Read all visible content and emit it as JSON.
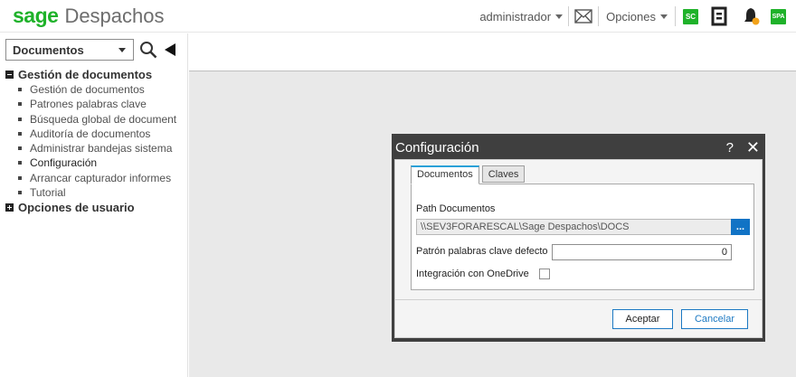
{
  "header": {
    "brand": "sage",
    "app_name": "Despachos",
    "user_menu": "administrador",
    "options_menu": "Opciones",
    "badge_sc": "SC",
    "badge_spa": "SPA",
    "icons": [
      "envelope-icon",
      "document-icon",
      "bell-icon"
    ],
    "colors": {
      "brand_green": "#1fb22a",
      "bell_dot": "#f2a21a"
    }
  },
  "sidebar": {
    "module_selector": "Documentos",
    "groups": [
      {
        "label": "Gestión de documentos",
        "expanded": true,
        "items": [
          {
            "label": "Gestión de documentos"
          },
          {
            "label": "Patrones palabras clave"
          },
          {
            "label": "Búsqueda global de document"
          },
          {
            "label": "Auditoría de documentos"
          },
          {
            "label": "Administrar bandejas sistema"
          },
          {
            "label": "Configuración",
            "active": true
          },
          {
            "label": "Arrancar capturador informes"
          },
          {
            "label": "Tutorial"
          }
        ]
      },
      {
        "label": "Opciones de usuario",
        "expanded": false
      }
    ]
  },
  "dialog": {
    "title": "Configuración",
    "help": "?",
    "close": "✕",
    "tabs": [
      {
        "label": "Documentos",
        "active": true
      },
      {
        "label": "Claves",
        "active": false
      }
    ],
    "path_label": "Path Documentos",
    "path_value": "\\\\SEV3FORARESCAL\\Sage Despachos\\DOCS",
    "browse_label": "...",
    "pattern_label": "Patrón palabras clave defecto",
    "pattern_value": "0",
    "onedrive_label": "Integración con OneDrive",
    "onedrive_checked": false,
    "accept_button": "Aceptar",
    "cancel_button": "Cancelar",
    "colors": {
      "title_bar": "#3f3f3f",
      "accent_blue": "#1173c5",
      "tab_accent": "#2aa1d8"
    }
  }
}
